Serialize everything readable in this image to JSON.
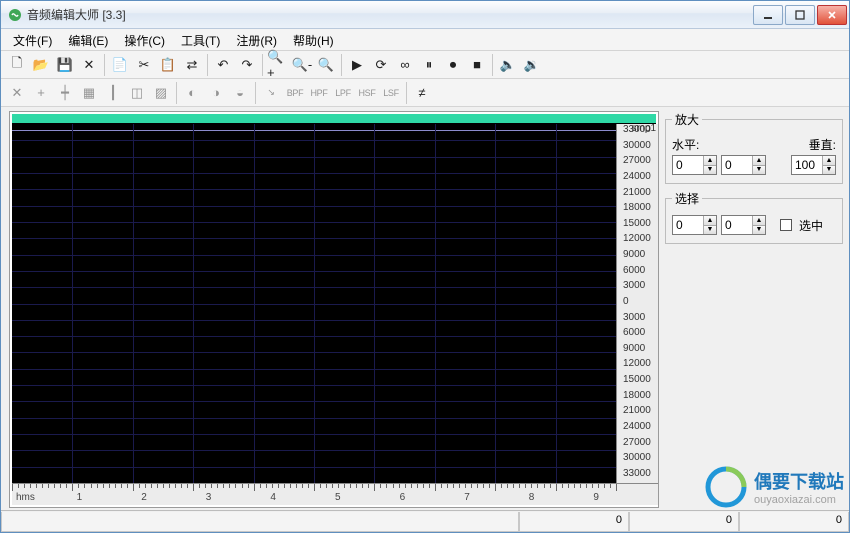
{
  "window": {
    "title": "音频编辑大师  [3.3]"
  },
  "menu": {
    "file": "文件(F)",
    "edit": "编辑(E)",
    "operate": "操作(C)",
    "tools": "工具(T)",
    "register": "注册(R)",
    "help": "帮助(H)"
  },
  "toolbar1": {
    "new": "🗋",
    "open": "📂",
    "save": "💾",
    "delete": "✕",
    "copy": "📄",
    "cut": "✂",
    "paste": "📋",
    "swap": "⇄",
    "undo": "↶",
    "redo": "↷",
    "zoomin": "🔍+",
    "zoomout": "🔍-",
    "zoomfit": "🔍",
    "play": "▶",
    "playloop": "⟳",
    "loop": "∞",
    "pause": "⏸",
    "rec": "⏺",
    "stop": "■",
    "spkL": "🔈",
    "spkR": "🔉"
  },
  "toolbar2": {
    "g1": [
      "✕",
      "+",
      "┿",
      "▦",
      "┃",
      "◫",
      "▨"
    ],
    "g2": [
      "◐",
      "◑",
      "◒"
    ],
    "g3": [
      "↘",
      "BPF",
      "HPF",
      "LPF",
      "HSF",
      "LSF"
    ],
    "g4": "≠"
  },
  "wave": {
    "sample_label": "smp1",
    "y_ticks": [
      "33000",
      "30000",
      "27000",
      "24000",
      "21000",
      "18000",
      "15000",
      "12000",
      "9000",
      "6000",
      "3000",
      "0",
      "3000",
      "6000",
      "9000",
      "12000",
      "15000",
      "18000",
      "21000",
      "24000",
      "27000",
      "30000",
      "33000"
    ],
    "x_hms": "hms",
    "x_ticks": [
      "1",
      "2",
      "3",
      "4",
      "5",
      "6",
      "7",
      "8",
      "9"
    ]
  },
  "panels": {
    "zoom": {
      "legend": "放大",
      "horiz_label": "水平:",
      "vert_label": "垂直:",
      "h1": "0",
      "h2": "0",
      "v": "100"
    },
    "select": {
      "legend": "选择",
      "a": "0",
      "b": "0",
      "checkbox_label": "选中"
    }
  },
  "status": {
    "c1": "",
    "c2": "0",
    "c3": "0",
    "c4": "0"
  },
  "watermark": {
    "line1": "偶要下载站",
    "line2": "ouyaoxiazai.com"
  },
  "chart_data": {
    "type": "line",
    "title": "",
    "series": [
      {
        "name": "smp1",
        "values": []
      }
    ],
    "x": [],
    "xlabel": "hms",
    "ylabel": "",
    "ylim": [
      -33000,
      33000
    ],
    "xlim": [
      0,
      10
    ]
  }
}
